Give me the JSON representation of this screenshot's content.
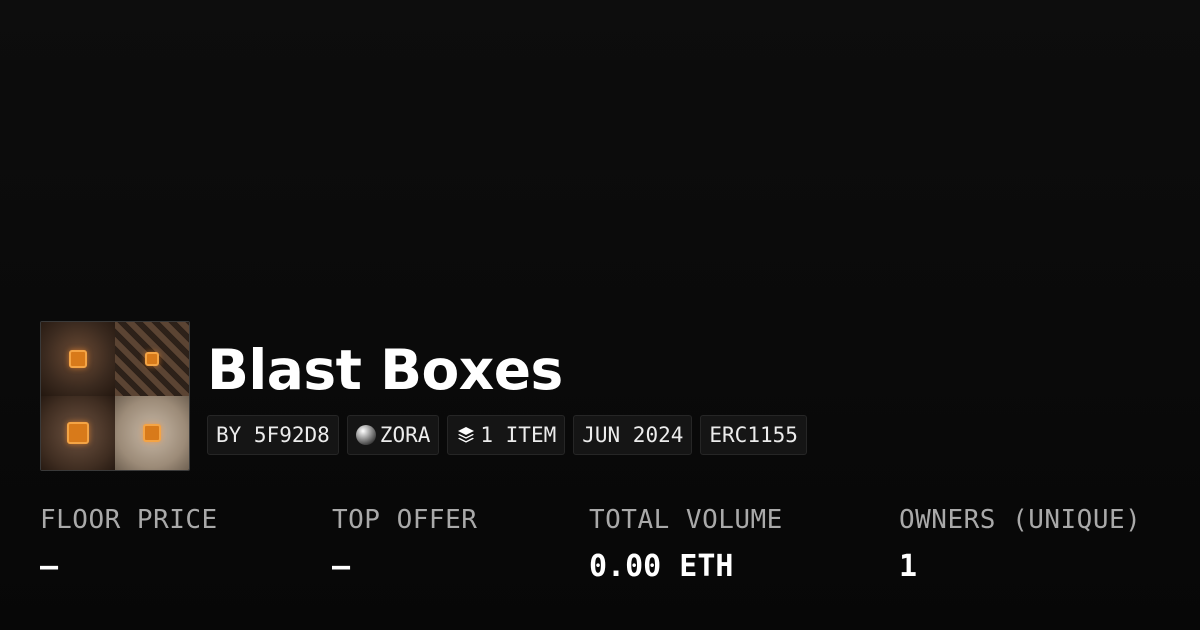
{
  "collection": {
    "name": "Blast Boxes",
    "thumbnail_alt": "Blast Boxes collection artwork"
  },
  "tags": {
    "creator": "BY 5F92D8",
    "chain": "ZORA",
    "items": "1 ITEM",
    "date": "JUN 2024",
    "standard": "ERC1155"
  },
  "icons": {
    "chain": "zora-sphere-icon",
    "items": "layers-icon"
  },
  "stats": {
    "floor_price_label": "FLOOR PRICE",
    "floor_price_value": "—",
    "top_offer_label": "TOP OFFER",
    "top_offer_value": "—",
    "total_volume_label": "TOTAL VOLUME",
    "total_volume_value": "0.00 ETH",
    "owners_label": "OWNERS (UNIQUE)",
    "owners_value": "1"
  },
  "colors": {
    "background": "#0b0b0b",
    "tag_background": "#151515",
    "label_text": "#a9a9a9",
    "accent_orange": "#d87a1a"
  }
}
